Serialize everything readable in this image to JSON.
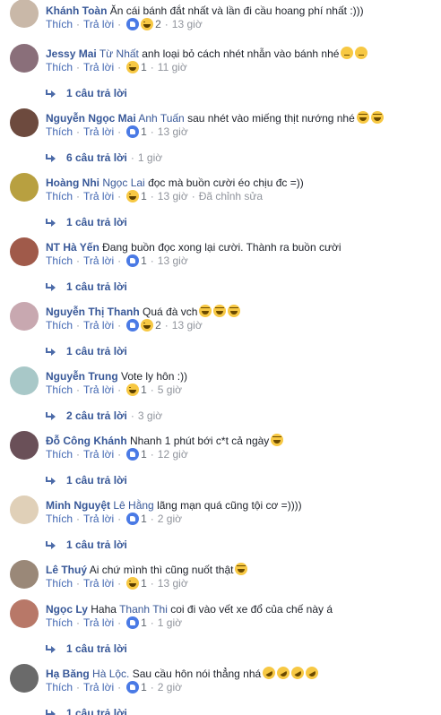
{
  "labels": {
    "like": "Thích",
    "reply": "Trả lời",
    "separator": "·"
  },
  "colors": {
    "link": "#385898",
    "action": "#4267b2",
    "muted": "#90949c",
    "like_reaction": "#4a7ae5",
    "haha_reaction": "#f7c843"
  },
  "comments": [
    {
      "author": "Khánh Toàn",
      "tag": "",
      "text": "Ăn cái bánh đắt nhất và lần đi cầu hoang phí nhất :)))",
      "text_emojis": [],
      "reactions": [
        "like",
        "haha"
      ],
      "reaction_count": "2",
      "time": "13 giờ",
      "edited": "",
      "replies": "",
      "reply_time": "",
      "avatar": "#c9b8a8"
    },
    {
      "author": "Jessy Mai",
      "tag": "Từ Nhất",
      "text": "anh loại bỏ cách nhét nhẫn vào bánh nhé",
      "text_emojis": [
        "thinking-face",
        "thinking-face"
      ],
      "reactions": [
        "haha"
      ],
      "reaction_count": "1",
      "time": "11 giờ",
      "edited": "",
      "replies": "1 câu trả lời",
      "reply_time": "",
      "avatar": "#8a6f7a"
    },
    {
      "author": "Nguyễn Ngọc Mai",
      "tag": "Anh Tuấn",
      "text": "sau nhét vào miếng thịt nướng nhé",
      "text_emojis": [
        "laughing-face",
        "laughing-face"
      ],
      "reactions": [
        "like"
      ],
      "reaction_count": "1",
      "time": "13 giờ",
      "edited": "",
      "replies": "6 câu trả lời",
      "reply_time": "1 giờ",
      "avatar": "#6d4a3e"
    },
    {
      "author": "Hoàng Nhi",
      "tag": "Ngọc Lai",
      "text": "đọc mà buồn cười éo chịu đc =))",
      "text_emojis": [],
      "reactions": [
        "haha"
      ],
      "reaction_count": "1",
      "time": "13 giờ",
      "edited": "Đã chỉnh sửa",
      "replies": "1 câu trả lời",
      "reply_time": "",
      "avatar": "#b8a040"
    },
    {
      "author": "NT Hà Yến",
      "tag": "",
      "text": "Đang buồn đọc xong lại cười. Thành ra buồn cười",
      "text_emojis": [],
      "reactions": [
        "like"
      ],
      "reaction_count": "1",
      "time": "13 giờ",
      "edited": "",
      "replies": "1 câu trả lời",
      "reply_time": "",
      "avatar": "#a05a4a"
    },
    {
      "author": "Nguyễn Thị Thanh",
      "tag": "",
      "text": "Quá đà vch",
      "text_emojis": [
        "laughing-face",
        "laughing-face",
        "laughing-face"
      ],
      "reactions": [
        "like",
        "haha"
      ],
      "reaction_count": "2",
      "time": "13 giờ",
      "edited": "",
      "replies": "1 câu trả lời",
      "reply_time": "",
      "avatar": "#c8a8b0"
    },
    {
      "author": "Nguyễn Trung",
      "tag": "",
      "text": "Vote ly hôn :))",
      "text_emojis": [],
      "reactions": [
        "haha"
      ],
      "reaction_count": "1",
      "time": "5 giờ",
      "edited": "",
      "replies": "2 câu trả lời",
      "reply_time": "3 giờ",
      "avatar": "#a8c8c8"
    },
    {
      "author": "Đỗ Công Khánh",
      "tag": "",
      "text": "Nhanh 1 phút bới c*t cả ngày",
      "text_emojis": [
        "laughing-face"
      ],
      "reactions": [
        "like"
      ],
      "reaction_count": "1",
      "time": "12 giờ",
      "edited": "",
      "replies": "1 câu trả lời",
      "reply_time": "",
      "avatar": "#6a5058"
    },
    {
      "author": "Minh Nguyệt",
      "tag": "Lê Hằng",
      "text": "lãng mạn quá cũng tội cơ =))))",
      "text_emojis": [],
      "reactions": [
        "like"
      ],
      "reaction_count": "1",
      "time": "2 giờ",
      "edited": "",
      "replies": "1 câu trả lời",
      "reply_time": "",
      "avatar": "#e0d0b8"
    },
    {
      "author": "Lê Thuý",
      "tag": "",
      "text": "Ai chứ mình thì cũng nuốt thật",
      "text_emojis": [
        "laughing-face"
      ],
      "reactions": [
        "haha"
      ],
      "reaction_count": "1",
      "time": "13 giờ",
      "edited": "",
      "replies": "",
      "reply_time": "",
      "avatar": "#9a8878"
    },
    {
      "author": "Ngọc Ly",
      "tag": "",
      "text_pre": "Haha",
      "tag2": "Thanh Thi",
      "text": "coi đi vào vết xe đổ của chế này á",
      "text_emojis": [],
      "reactions": [
        "like"
      ],
      "reaction_count": "1",
      "time": "1 giờ",
      "edited": "",
      "replies": "1 câu trả lời",
      "reply_time": "",
      "avatar": "#b87868"
    },
    {
      "author": "Hạ Băng",
      "tag": "Hà Lộc.",
      "text": "Sau cầu hôn nói thẳng nhá",
      "text_emojis": [
        "rofl-face",
        "rofl-face",
        "rofl-face",
        "rofl-face"
      ],
      "reactions": [
        "like"
      ],
      "reaction_count": "1",
      "time": "2 giờ",
      "edited": "",
      "replies": "1 câu trả lời",
      "reply_time": "",
      "avatar": "#6a6a6a"
    }
  ]
}
